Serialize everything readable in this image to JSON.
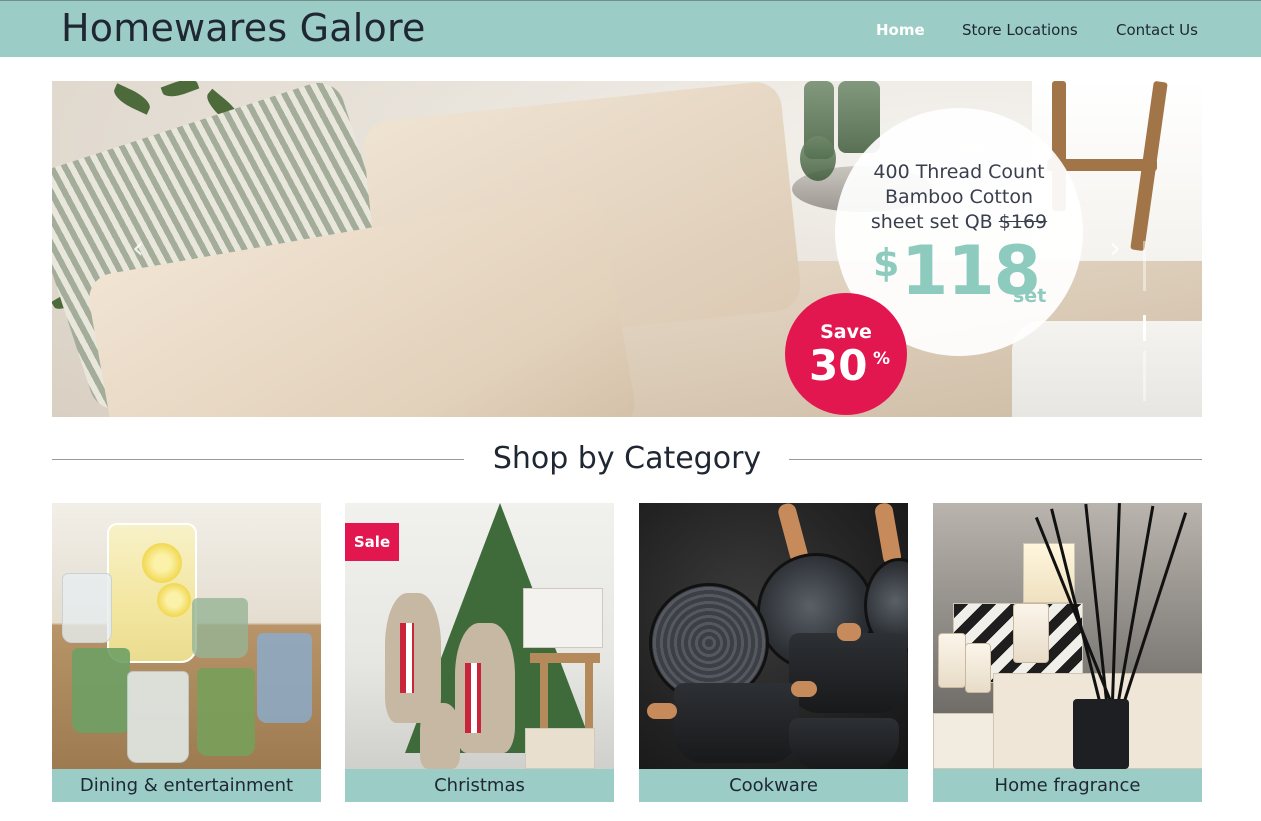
{
  "header": {
    "brand": "Homewares Galore",
    "nav": [
      {
        "label": "Home",
        "active": true
      },
      {
        "label": "Store Locations",
        "active": false
      },
      {
        "label": "Contact Us",
        "active": false
      }
    ],
    "background_color": "#9bccc6"
  },
  "hero": {
    "promo_line1": "400 Thread Count",
    "promo_line2": "Bamboo Cotton",
    "promo_line3": "sheet set QB",
    "old_price": "$169",
    "price_symbol": "$",
    "price_value": "118",
    "price_unit": "set",
    "save_label": "Save",
    "save_value": "30",
    "save_percent": "%",
    "prev_icon": "chevron-left-icon",
    "next_icon": "chevron-right-icon",
    "slide_count": 3,
    "active_slide": 2,
    "accent_color": "#e2174f",
    "price_color": "#8ecbbf"
  },
  "section": {
    "title": "Shop by Category"
  },
  "categories": [
    {
      "label": "Dining & entertainment",
      "badge": ""
    },
    {
      "label": "Christmas",
      "badge": "Sale"
    },
    {
      "label": "Cookware",
      "badge": ""
    },
    {
      "label": "Home fragrance",
      "badge": ""
    }
  ]
}
